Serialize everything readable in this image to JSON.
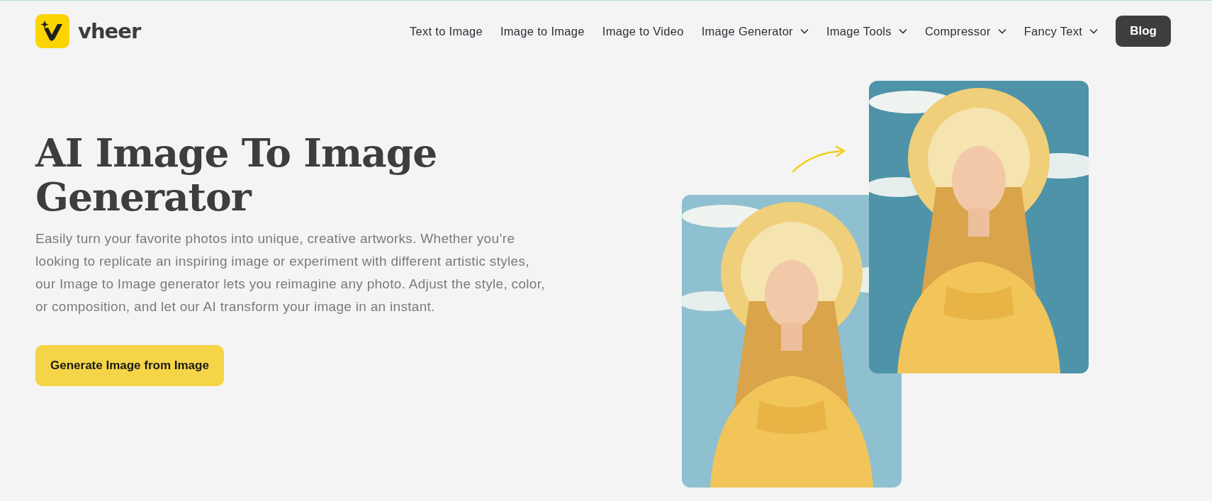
{
  "header": {
    "logo_text": "vheer",
    "nav": [
      {
        "label": "Text to Image",
        "kind": "link"
      },
      {
        "label": "Image to Image",
        "kind": "link"
      },
      {
        "label": "Image to Video",
        "kind": "link"
      },
      {
        "label": "Image Generator",
        "kind": "dropdown"
      },
      {
        "label": "Image Tools",
        "kind": "dropdown"
      },
      {
        "label": "Compressor",
        "kind": "dropdown"
      },
      {
        "label": "Fancy Text",
        "kind": "dropdown"
      },
      {
        "label": "Blog",
        "kind": "button"
      }
    ]
  },
  "hero": {
    "title": "AI Image To Image Generator",
    "description": "Easily turn your favorite photos into unique, creative artworks. Whether you’re looking to replicate an inspiring image or experiment with different artistic styles, our Image to Image generator lets you reimagine any photo. Adjust the style, color, or composition, and let our AI transform your image in an instant.",
    "cta": "Generate Image from Image"
  }
}
